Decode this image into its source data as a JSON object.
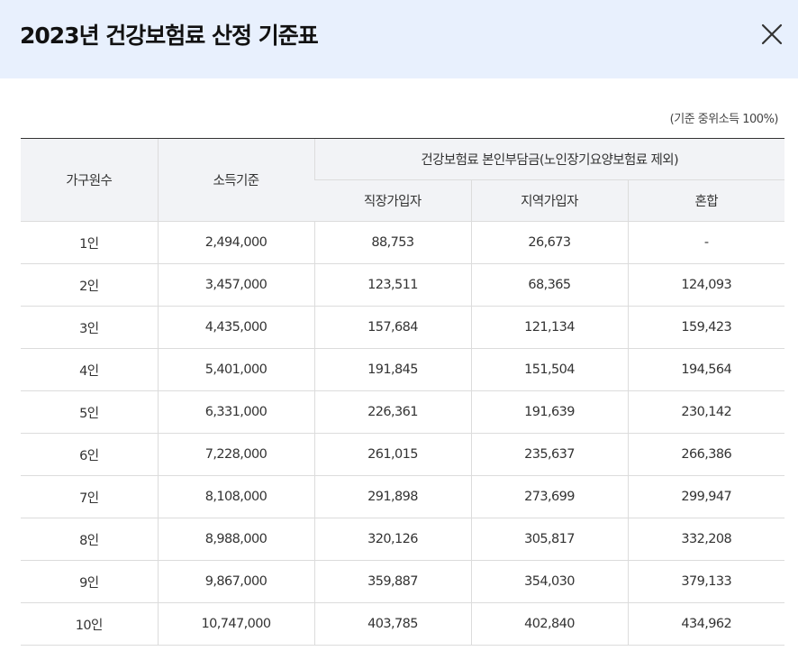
{
  "dialog": {
    "title": "2023년 건강보험료 산정 기준표",
    "close_icon": "close-icon",
    "header_bg": "#e8f0fd"
  },
  "caption": "(기준 중위소득 100%)",
  "table": {
    "headers": {
      "household": "가구원수",
      "income": "소득기준",
      "premium_group": "건강보험료 본인부담금(노인장기요양보험료 제외)",
      "employee": "직장가입자",
      "regional": "지역가입자",
      "mixed": "혼합"
    },
    "rows": [
      [
        "1인",
        "2,494,000",
        "88,753",
        "26,673",
        "-"
      ],
      [
        "2인",
        "3,457,000",
        "123,511",
        "68,365",
        "124,093"
      ],
      [
        "3인",
        "4,435,000",
        "157,684",
        "121,134",
        "159,423"
      ],
      [
        "4인",
        "5,401,000",
        "191,845",
        "151,504",
        "194,564"
      ],
      [
        "5인",
        "6,331,000",
        "226,361",
        "191,639",
        "230,142"
      ],
      [
        "6인",
        "7,228,000",
        "261,015",
        "235,637",
        "266,386"
      ],
      [
        "7인",
        "8,108,000",
        "291,898",
        "273,699",
        "299,947"
      ],
      [
        "8인",
        "8,988,000",
        "320,126",
        "305,817",
        "332,208"
      ],
      [
        "9인",
        "9,867,000",
        "359,887",
        "354,030",
        "379,133"
      ],
      [
        "10인",
        "10,747,000",
        "403,785",
        "402,840",
        "434,962"
      ]
    ]
  }
}
